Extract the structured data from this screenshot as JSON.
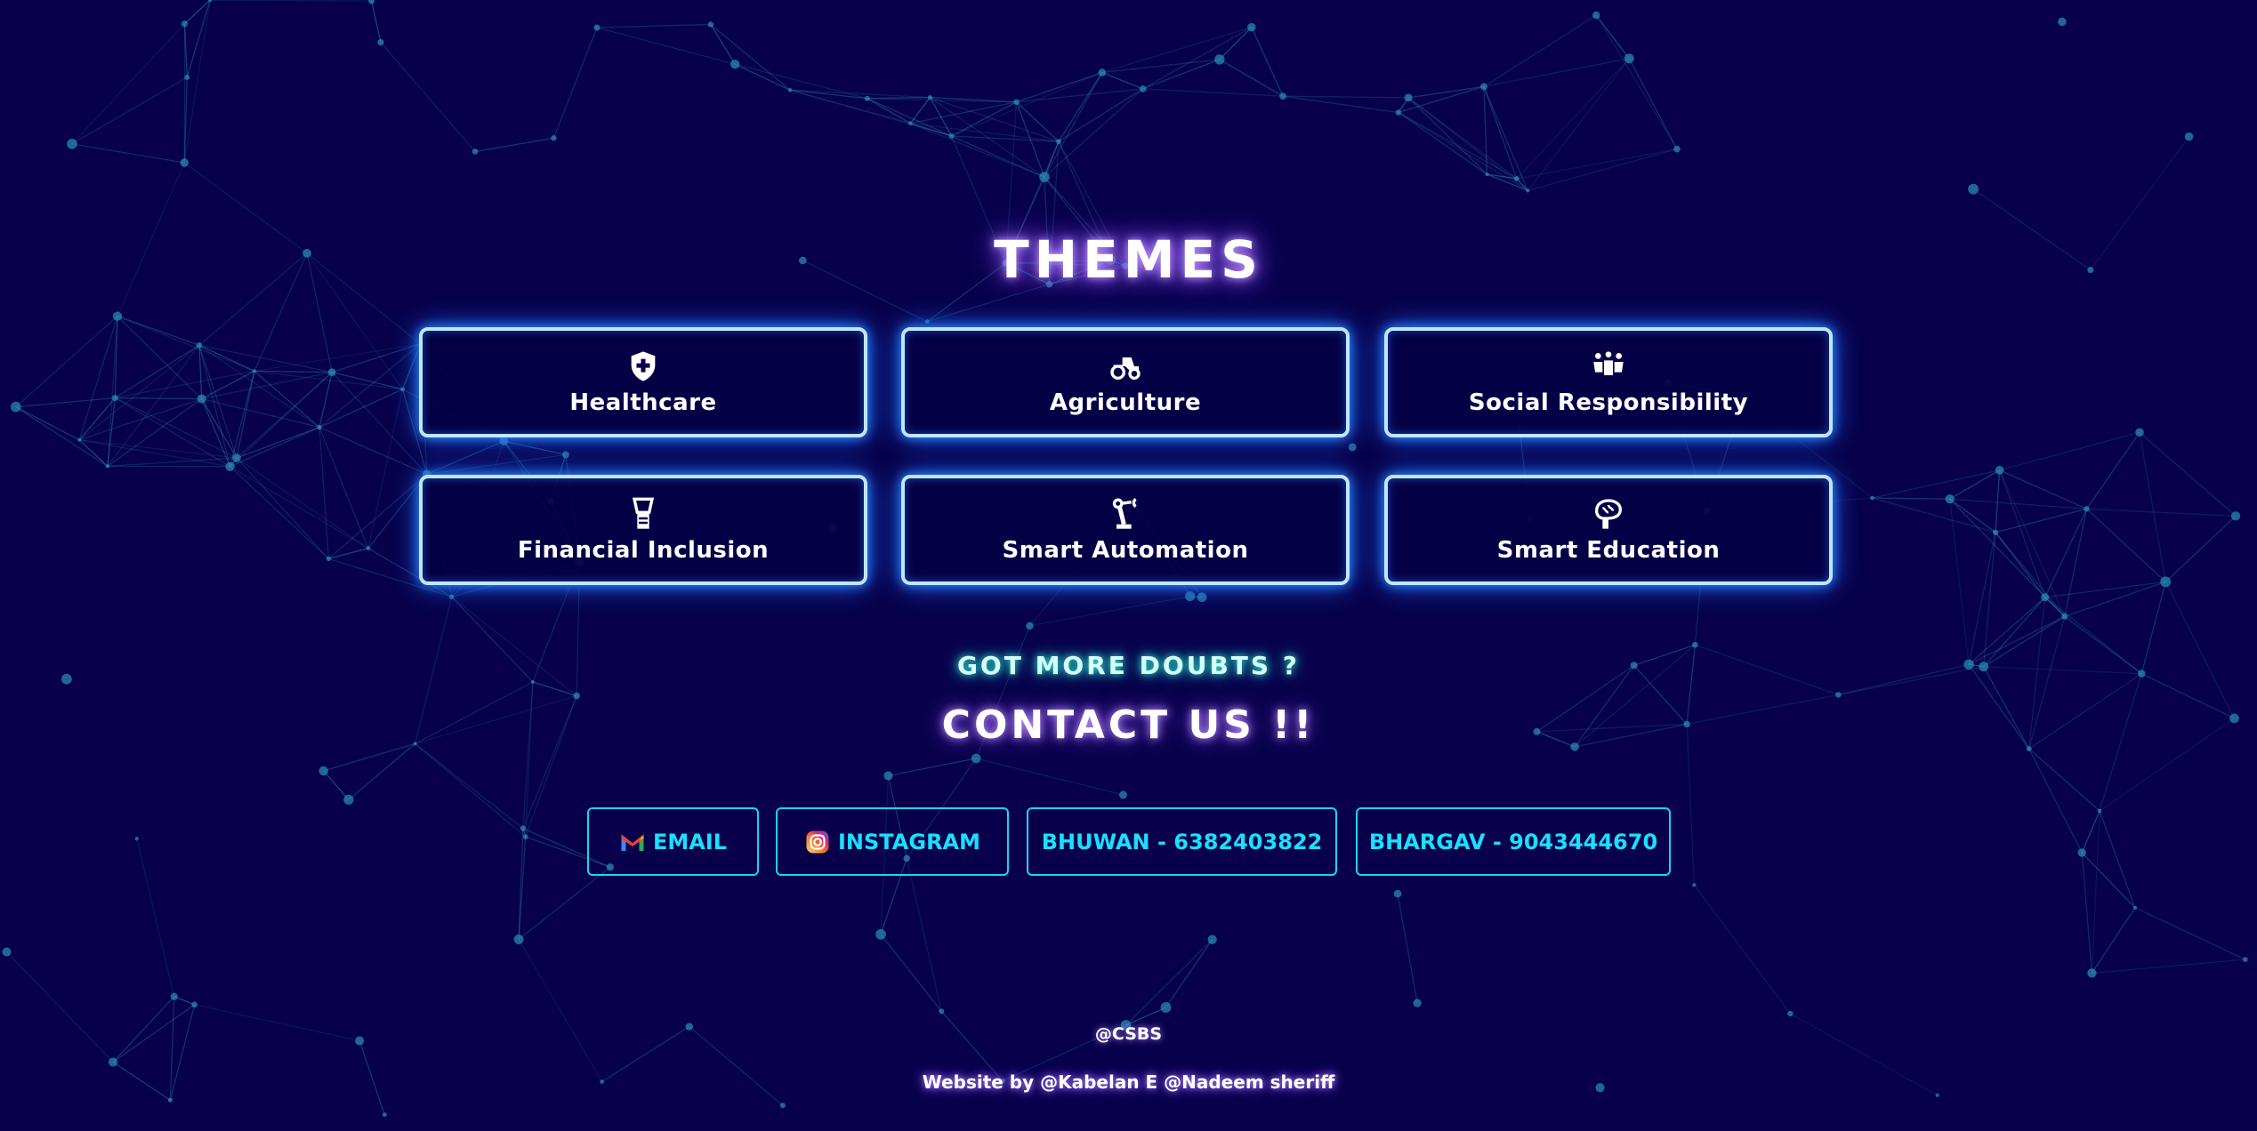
{
  "themes": {
    "title": "THEMES",
    "items": [
      {
        "label": "Healthcare",
        "icon": "shield-plus-icon"
      },
      {
        "label": "Agriculture",
        "icon": "tractor-icon"
      },
      {
        "label": "Social Responsibility",
        "icon": "people-icon"
      },
      {
        "label": "Financial Inclusion",
        "icon": "money-hand-icon"
      },
      {
        "label": "Smart Automation",
        "icon": "robot-arm-icon"
      },
      {
        "label": "Smart Education",
        "icon": "brain-icon"
      }
    ]
  },
  "contact": {
    "subtitle": "GOT MORE DOUBTS ?",
    "title": "CONTACT US !!",
    "buttons": [
      {
        "label": "EMAIL",
        "icon": "gmail-icon"
      },
      {
        "label": "INSTAGRAM",
        "icon": "instagram-icon"
      },
      {
        "label": "BHUWAN - 6382403822"
      },
      {
        "label": "BHARGAV - 9043444670"
      }
    ]
  },
  "footer": {
    "org": "@CSBS",
    "credit": "Website by @Kabelan E @Nadeem sheriff"
  },
  "colors": {
    "background": "#08004a",
    "card_border": "#bfe6ff",
    "contact_accent": "#19e0ff"
  }
}
